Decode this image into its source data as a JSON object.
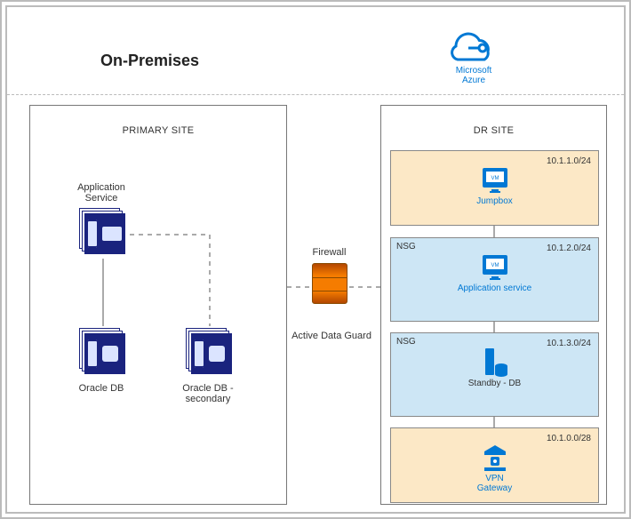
{
  "onprem_title": "On-Premises",
  "azure_label_l1": "Microsoft",
  "azure_label_l2": "Azure",
  "primary_site_title": "PRIMARY SITE",
  "dr_site_title": "DR SITE",
  "app_service_label": "Application Service",
  "oracle_db_label": "Oracle DB",
  "oracle_db_secondary_label": "Oracle DB - secondary",
  "firewall_label": "Firewall",
  "active_data_guard_label": "Active Data Guard",
  "nsg_label": "NSG",
  "subnets": {
    "jumpbox": {
      "cidr": "10.1.1.0/24",
      "label": "Jumpbox"
    },
    "appsvc": {
      "cidr": "10.1.2.0/24",
      "label": "Application service"
    },
    "standby": {
      "cidr": "10.1.3.0/24",
      "label": "Standby - DB"
    },
    "gateway": {
      "cidr": "10.1.0.0/28",
      "label_l1": "VPN",
      "label_l2": "Gateway"
    }
  },
  "colors": {
    "azure_blue": "#0078D4",
    "onprem_navy": "#1a237e",
    "subnet_tan": "#fce8c6",
    "subnet_blue": "#cde6f5"
  }
}
